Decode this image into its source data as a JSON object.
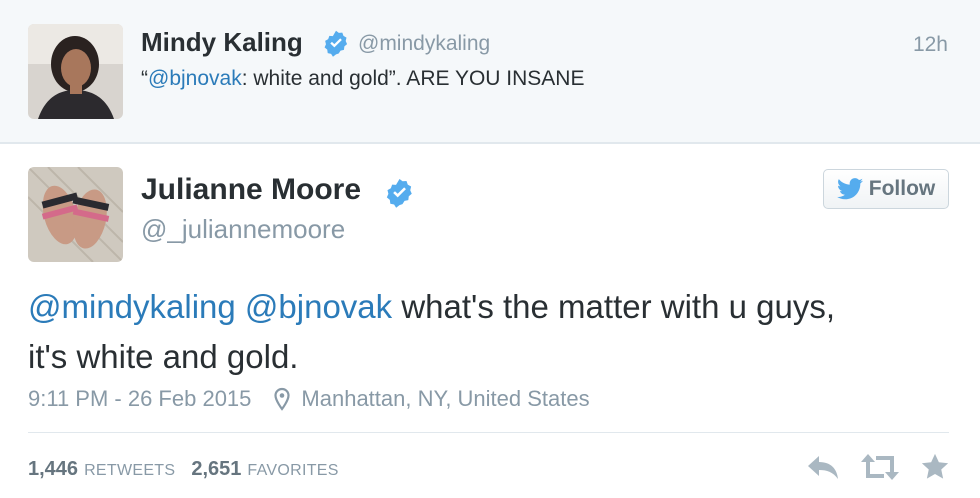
{
  "top_tweet": {
    "name": "Mindy Kaling",
    "handle": "@mindykaling",
    "time": "12h",
    "text_open": "“",
    "mention": "@bjnovak",
    "text_rest": ": white and gold”. ARE YOU INSANE"
  },
  "main_tweet": {
    "name": "Julianne Moore",
    "handle": "@_juliannemoore",
    "follow_label": "Follow",
    "mention1": "@mindykaling",
    "mention2": "@bjnovak",
    "text_line1_rest": " what's the matter with u guys,",
    "text_line2": "it's white and gold.",
    "timestamp": "9:11 PM - 26 Feb 2015",
    "location": "Manhattan, NY, United States",
    "retweets_count": "1,446",
    "retweets_label": "RETWEETS",
    "favorites_count": "2,651",
    "favorites_label": "FAVORITES"
  },
  "icons": {
    "verified": "verified-badge-icon",
    "follow_bird": "twitter-bird-icon",
    "location": "location-pin-icon",
    "reply": "reply-icon",
    "retweet": "retweet-icon",
    "favorite": "star-icon"
  },
  "colors": {
    "link": "#2b7bb9",
    "verified": "#55acee",
    "muted": "#8899a6",
    "text": "#292f33",
    "top_background": "#f5f8fa"
  }
}
